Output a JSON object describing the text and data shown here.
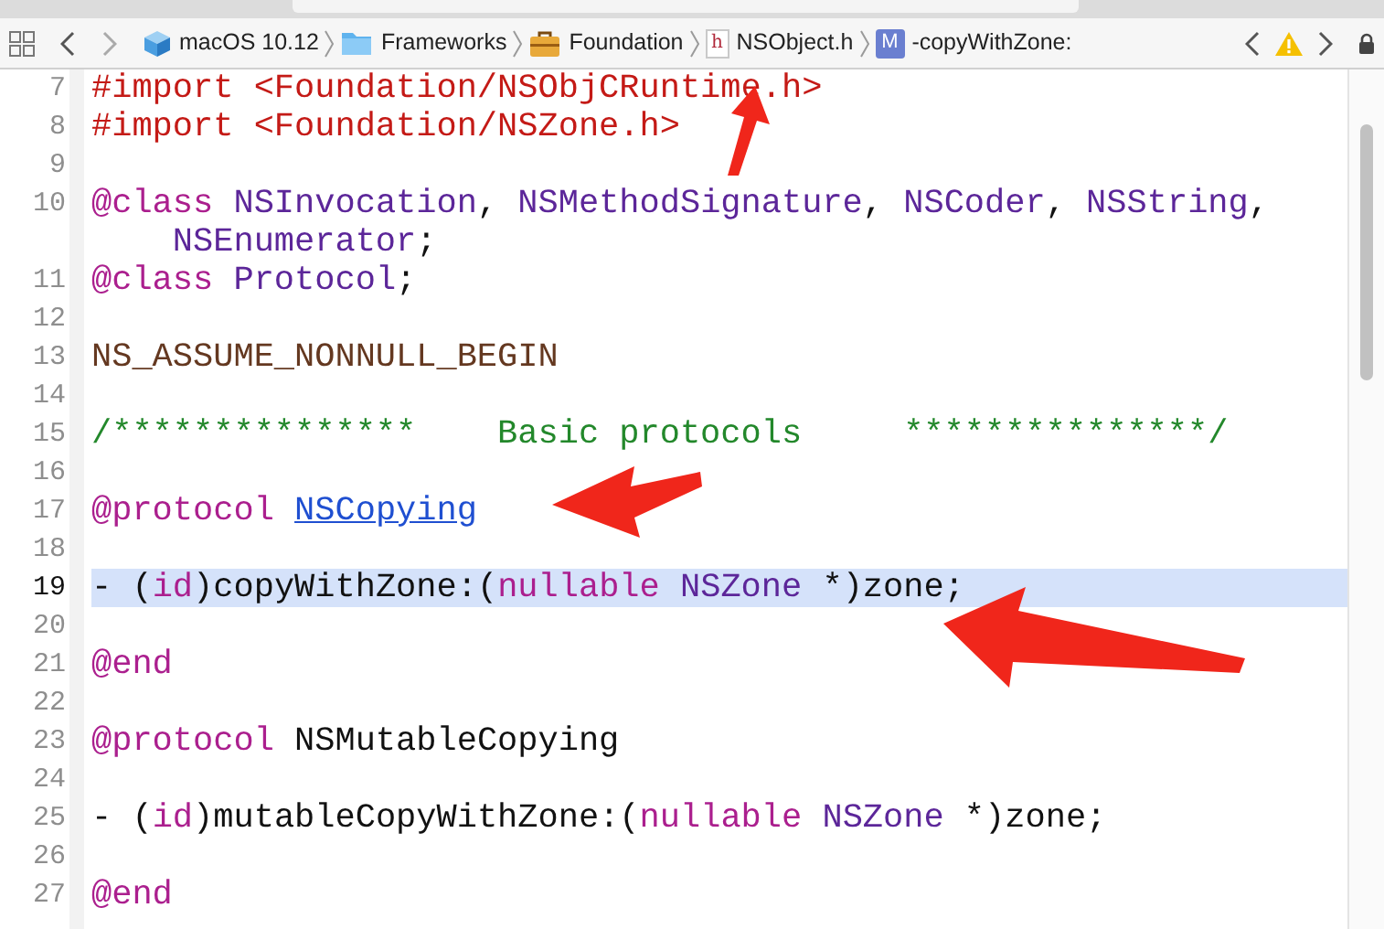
{
  "jump_bar": {
    "items": [
      {
        "label": "macOS 10.12"
      },
      {
        "label": "Frameworks"
      },
      {
        "label": "Foundation"
      },
      {
        "label": "NSObject.h",
        "icon_letter": "h"
      },
      {
        "label": "-copyWithZone:",
        "icon_letter": "M"
      }
    ]
  },
  "editor": {
    "lines": [
      {
        "number": "7",
        "current": false,
        "segments": [
          {
            "kind": "string",
            "text": "#import <Foundation/NSObjCRuntime.h>"
          }
        ]
      },
      {
        "number": "8",
        "current": false,
        "segments": [
          {
            "kind": "string",
            "text": "#import <Foundation/NSZone.h>"
          }
        ]
      },
      {
        "number": "9",
        "current": false
      },
      {
        "number": "10",
        "current": false,
        "segments": [
          {
            "kind": "keyword",
            "text": "@class"
          },
          {
            "kind": "type",
            "text": " NSInvocation"
          },
          {
            "kind": "plain",
            "text": ","
          },
          {
            "kind": "type",
            "text": " NSMethodSignature"
          },
          {
            "kind": "plain",
            "text": ","
          },
          {
            "kind": "type",
            "text": " NSCoder"
          },
          {
            "kind": "plain",
            "text": ","
          },
          {
            "kind": "type",
            "text": " NSString"
          },
          {
            "kind": "plain",
            "text": ","
          }
        ]
      },
      {
        "current": false,
        "segments": [
          {
            "kind": "type",
            "text": "    NSEnumerator"
          },
          {
            "kind": "plain",
            "text": ";"
          }
        ]
      },
      {
        "number": "11",
        "current": false,
        "segments": [
          {
            "kind": "keyword",
            "text": "@class"
          },
          {
            "kind": "type",
            "text": " Protocol"
          },
          {
            "kind": "plain",
            "text": ";"
          }
        ]
      },
      {
        "number": "12",
        "current": false
      },
      {
        "number": "13",
        "current": false,
        "segments": [
          {
            "kind": "macro",
            "text": "NS_ASSUME_NONNULL_BEGIN"
          }
        ]
      },
      {
        "number": "14",
        "current": false
      },
      {
        "number": "15",
        "current": false,
        "segments": [
          {
            "kind": "comment",
            "text": "/***************    Basic protocols     ***************/"
          }
        ]
      },
      {
        "number": "16",
        "current": false
      },
      {
        "number": "17",
        "current": false,
        "segments": [
          {
            "kind": "keyword",
            "text": "@protocol "
          },
          {
            "kind": "link",
            "text": "NSCopying"
          }
        ]
      },
      {
        "number": "18",
        "current": false
      },
      {
        "number": "19",
        "current": true,
        "segments": [
          {
            "kind": "plain",
            "text": "- ("
          },
          {
            "kind": "keyword",
            "text": "id"
          },
          {
            "kind": "plain",
            "text": ")copyWithZone:("
          },
          {
            "kind": "keyword",
            "text": "nullable"
          },
          {
            "kind": "type",
            "text": " NSZone"
          },
          {
            "kind": "plain",
            "text": " *)zone;"
          }
        ]
      },
      {
        "number": "20",
        "current": false
      },
      {
        "number": "21",
        "current": false,
        "segments": [
          {
            "kind": "keyword",
            "text": "@end"
          }
        ]
      },
      {
        "number": "22",
        "current": false
      },
      {
        "number": "23",
        "current": false,
        "segments": [
          {
            "kind": "keyword",
            "text": "@protocol"
          },
          {
            "kind": "plain",
            "text": " NSMutableCopying"
          }
        ]
      },
      {
        "number": "24",
        "current": false
      },
      {
        "number": "25",
        "current": false,
        "segments": [
          {
            "kind": "plain",
            "text": "- ("
          },
          {
            "kind": "keyword",
            "text": "id"
          },
          {
            "kind": "plain",
            "text": ")mutableCopyWithZone:("
          },
          {
            "kind": "keyword",
            "text": "nullable"
          },
          {
            "kind": "type",
            "text": " NSZone"
          },
          {
            "kind": "plain",
            "text": " *)zone;"
          }
        ]
      },
      {
        "number": "26",
        "current": false
      },
      {
        "number": "27",
        "current": false,
        "segments": [
          {
            "kind": "keyword",
            "text": "@end"
          }
        ]
      }
    ]
  }
}
